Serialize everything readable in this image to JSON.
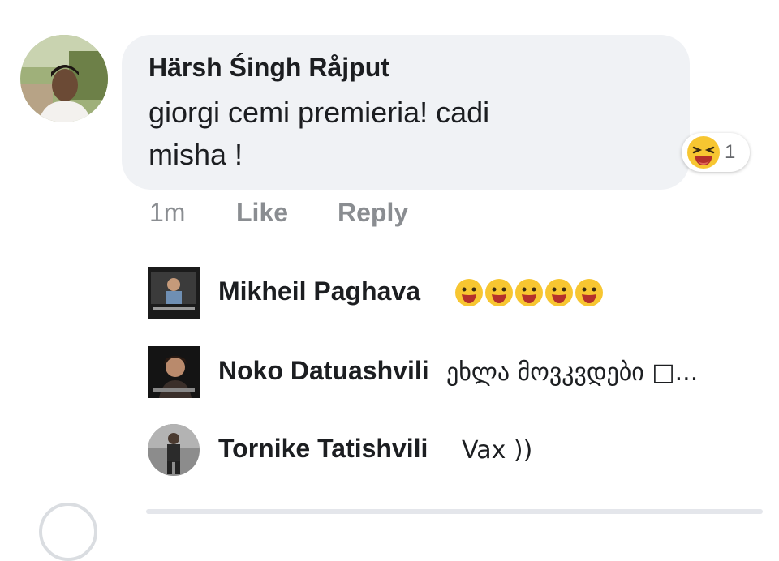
{
  "comment": {
    "author": "Härsh Śingh Råjput",
    "text_line1": "giorgi cemi premieria! cadi",
    "text_line2": "misha !",
    "reaction": {
      "icon": "laughing-emoji-icon",
      "count": "1"
    },
    "actions": {
      "time": "1m",
      "like": "Like",
      "reply": "Reply"
    }
  },
  "replies": [
    {
      "author": "Mikheil Paghava",
      "text": "",
      "emojis": [
        "smiley-emoji-icon",
        "smiley-emoji-icon",
        "smiley-emoji-icon",
        "smiley-emoji-icon",
        "smiley-emoji-icon"
      ]
    },
    {
      "author": "Noko Datuashvili",
      "text": "ეხლა მოვკვდები □..."
    },
    {
      "author": "Tornike Tatishvili",
      "text": "Vax ))"
    }
  ],
  "colors": {
    "bubble": "#f0f2f5",
    "action_text": "#8a8d91",
    "emoji_face": "#f7c631",
    "emoji_mouth": "#b5302a"
  }
}
